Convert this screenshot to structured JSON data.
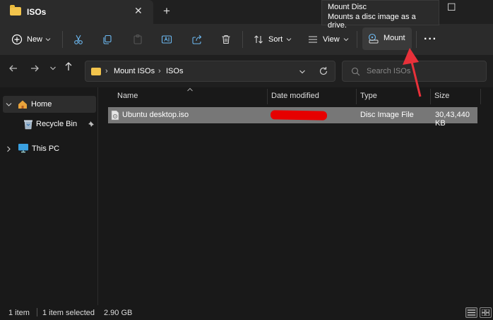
{
  "window": {
    "tab_title": "ISOs",
    "tab_close": "✕",
    "new_tab": "+",
    "maximize": "☐"
  },
  "tooltip": {
    "title": "Mount Disc",
    "description": "Mounts a disc image as a drive."
  },
  "toolbar": {
    "new_label": "New",
    "sort_label": "Sort",
    "view_label": "View",
    "mount_label": "Mount",
    "more_label": "···",
    "icons": [
      "new-icon",
      "cut-icon",
      "copy-icon",
      "paste-icon",
      "rename-icon",
      "share-icon",
      "delete-icon",
      "sort-icon",
      "view-icon",
      "mount-icon",
      "more-icon"
    ]
  },
  "address": {
    "crumbs": [
      "Mount ISOs",
      "ISOs"
    ],
    "separator": "›",
    "search_placeholder": "Search ISOs"
  },
  "sidebar": {
    "items": [
      {
        "label": "Home",
        "icon": "home-icon",
        "expanded": true
      },
      {
        "label": "Recycle Bin",
        "icon": "recycle-bin-icon",
        "pinned": true
      },
      {
        "label": "This PC",
        "icon": "pc-icon",
        "expanded": false
      }
    ]
  },
  "files": {
    "columns": [
      "Name",
      "Date modified",
      "Type",
      "Size"
    ],
    "rows": [
      {
        "name": "Ubuntu desktop.iso",
        "date_modified": "",
        "type": "Disc Image File",
        "size": "30,43,440 KB"
      }
    ]
  },
  "status": {
    "count": "1 item",
    "selected": "1 item selected",
    "size": "2.90 GB"
  },
  "colors": {
    "accent_folder": "#f3c44c",
    "arrow_annotation": "#e8313a",
    "selected_row": "#777777"
  }
}
